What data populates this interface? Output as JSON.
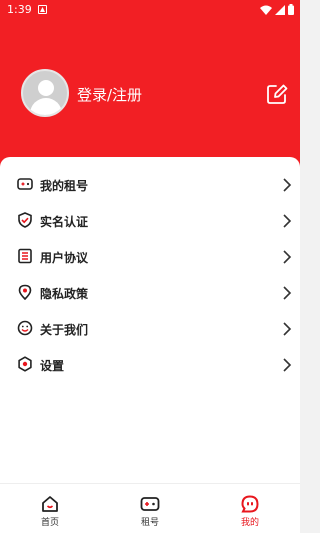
{
  "status_bar": {
    "time": "1:39"
  },
  "profile": {
    "login_label": "登录/注册"
  },
  "menu": [
    {
      "id": "my-rentals",
      "label": "我的租号",
      "icon": "gamepad-icon"
    },
    {
      "id": "real-name",
      "label": "实名认证",
      "icon": "shield-check-icon"
    },
    {
      "id": "user-agreement",
      "label": "用户协议",
      "icon": "document-list-icon"
    },
    {
      "id": "privacy-policy",
      "label": "隐私政策",
      "icon": "privacy-pin-icon"
    },
    {
      "id": "about-us",
      "label": "关于我们",
      "icon": "smiley-icon"
    },
    {
      "id": "settings",
      "label": "设置",
      "icon": "gear-icon"
    }
  ],
  "tabs": [
    {
      "id": "home",
      "label": "首页",
      "icon": "home-icon",
      "active": false
    },
    {
      "id": "rent",
      "label": "租号",
      "icon": "gamepad-icon",
      "active": false
    },
    {
      "id": "mine",
      "label": "我的",
      "icon": "profile-chat-icon",
      "active": true
    }
  ],
  "colors": {
    "brand_red": "#f21f24",
    "active_tab": "#e8161d",
    "text": "#222222"
  }
}
